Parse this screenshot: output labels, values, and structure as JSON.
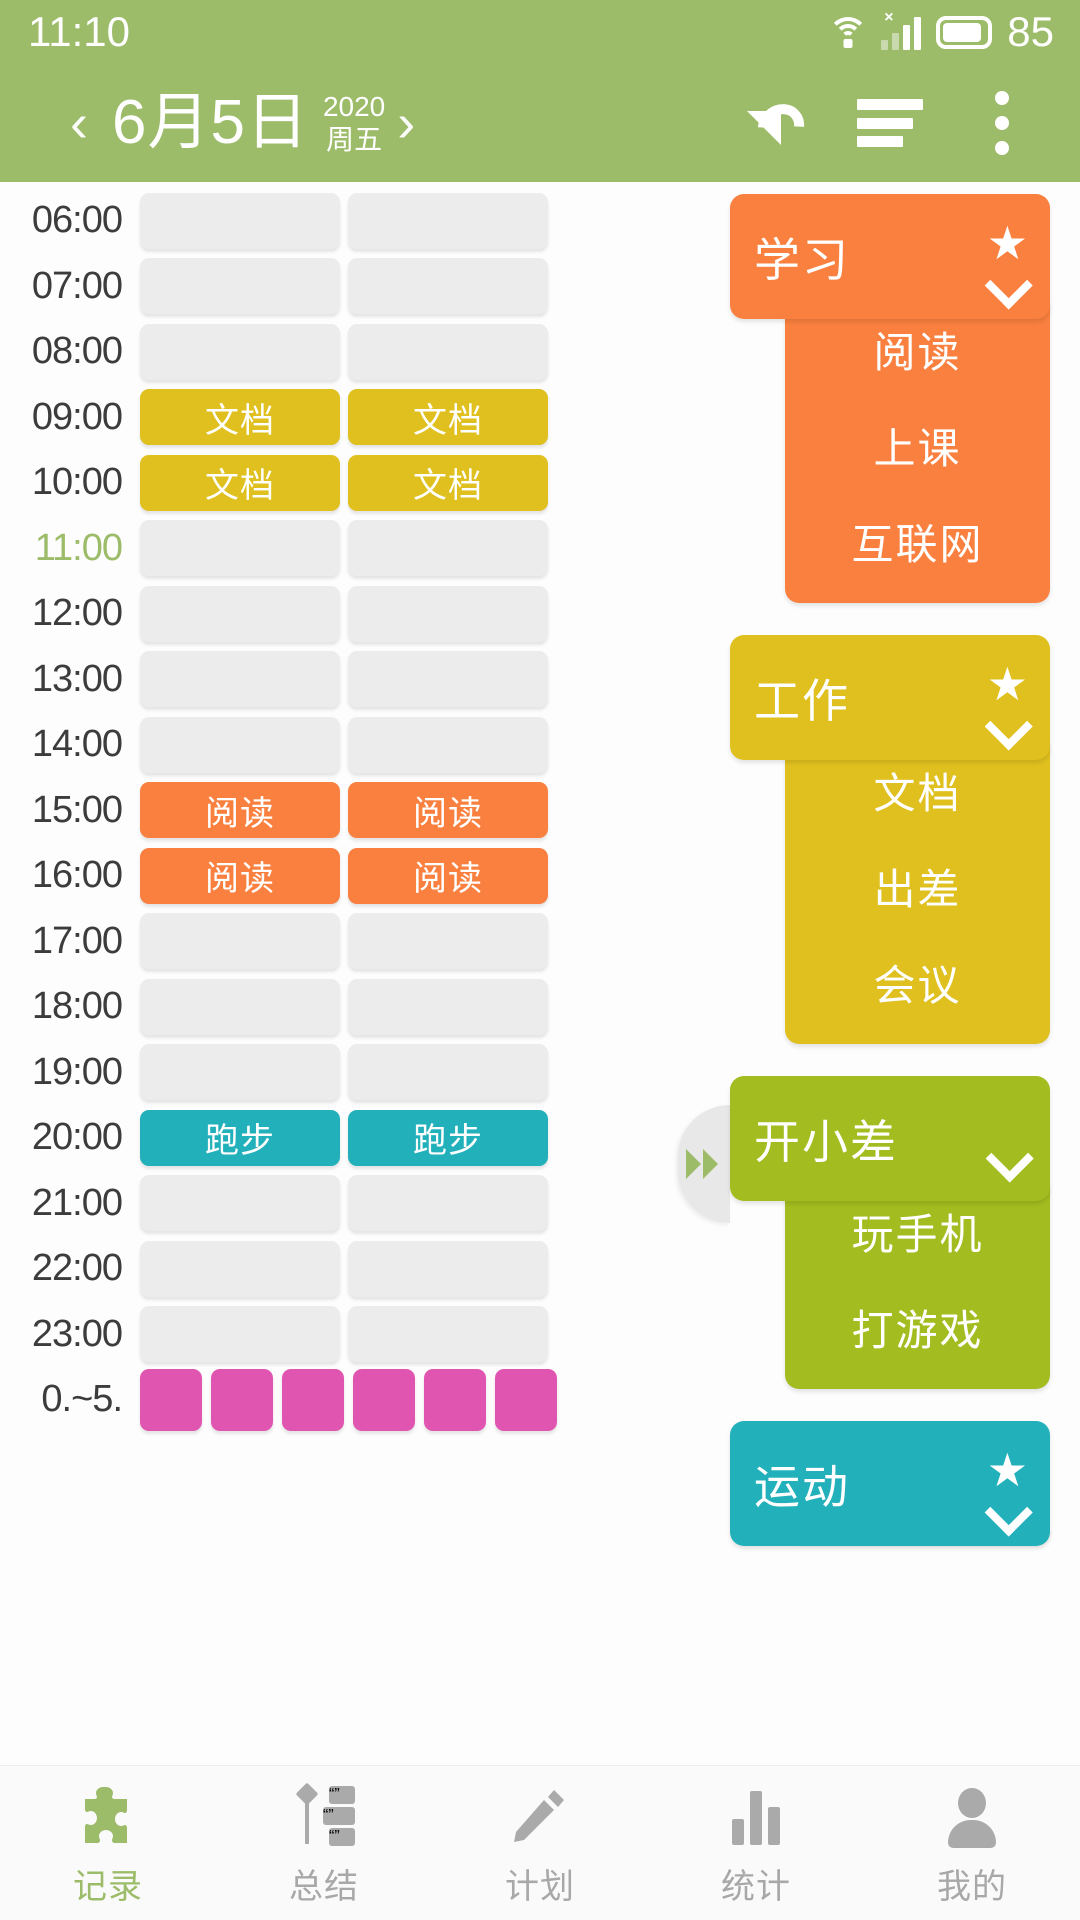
{
  "status_bar": {
    "time": "11:10",
    "battery_percent": "85",
    "wifi_icon": "wifi-icon",
    "signal_icon": "signal-bars-icon",
    "battery_icon": "battery-icon",
    "no_sim_mark": "×"
  },
  "app_bar": {
    "prev_label": "‹",
    "next_label": "›",
    "date": "6月5日",
    "year": "2020",
    "weekday": "周五",
    "undo_icon": "undo-icon",
    "lines_icon": "align-lines-icon",
    "overflow_icon": "more-vertical-icon"
  },
  "timeline": {
    "rows": [
      {
        "time": "06:00",
        "now": false,
        "cells": [
          {
            "label": "",
            "color": "#ececec"
          },
          {
            "label": "",
            "color": "#ececec"
          }
        ]
      },
      {
        "time": "07:00",
        "now": false,
        "cells": [
          {
            "label": "",
            "color": "#ececec"
          },
          {
            "label": "",
            "color": "#ececec"
          }
        ]
      },
      {
        "time": "08:00",
        "now": false,
        "cells": [
          {
            "label": "",
            "color": "#ececec"
          },
          {
            "label": "",
            "color": "#ececec"
          }
        ]
      },
      {
        "time": "09:00",
        "now": false,
        "cells": [
          {
            "label": "文档",
            "color": "#dfc01f"
          },
          {
            "label": "文档",
            "color": "#dfc01f"
          }
        ]
      },
      {
        "time": "10:00",
        "now": false,
        "cells": [
          {
            "label": "文档",
            "color": "#dfc01f"
          },
          {
            "label": "文档",
            "color": "#dfc01f"
          }
        ]
      },
      {
        "time": "11:00",
        "now": true,
        "cells": [
          {
            "label": "",
            "color": "#ececec"
          },
          {
            "label": "",
            "color": "#ececec"
          }
        ]
      },
      {
        "time": "12:00",
        "now": false,
        "cells": [
          {
            "label": "",
            "color": "#ececec"
          },
          {
            "label": "",
            "color": "#ececec"
          }
        ]
      },
      {
        "time": "13:00",
        "now": false,
        "cells": [
          {
            "label": "",
            "color": "#ececec"
          },
          {
            "label": "",
            "color": "#ececec"
          }
        ]
      },
      {
        "time": "14:00",
        "now": false,
        "cells": [
          {
            "label": "",
            "color": "#ececec"
          },
          {
            "label": "",
            "color": "#ececec"
          }
        ]
      },
      {
        "time": "15:00",
        "now": false,
        "cells": [
          {
            "label": "阅读",
            "color": "#f9803f"
          },
          {
            "label": "阅读",
            "color": "#f9803f"
          }
        ]
      },
      {
        "time": "16:00",
        "now": false,
        "cells": [
          {
            "label": "阅读",
            "color": "#f9803f"
          },
          {
            "label": "阅读",
            "color": "#f9803f"
          }
        ]
      },
      {
        "time": "17:00",
        "now": false,
        "cells": [
          {
            "label": "",
            "color": "#ececec"
          },
          {
            "label": "",
            "color": "#ececec"
          }
        ]
      },
      {
        "time": "18:00",
        "now": false,
        "cells": [
          {
            "label": "",
            "color": "#ececec"
          },
          {
            "label": "",
            "color": "#ececec"
          }
        ]
      },
      {
        "time": "19:00",
        "now": false,
        "cells": [
          {
            "label": "",
            "color": "#ececec"
          },
          {
            "label": "",
            "color": "#ececec"
          }
        ]
      },
      {
        "time": "20:00",
        "now": false,
        "cells": [
          {
            "label": "跑步",
            "color": "#22b0bb"
          },
          {
            "label": "跑步",
            "color": "#22b0bb"
          }
        ]
      },
      {
        "time": "21:00",
        "now": false,
        "cells": [
          {
            "label": "",
            "color": "#ececec"
          },
          {
            "label": "",
            "color": "#ececec"
          }
        ]
      },
      {
        "time": "22:00",
        "now": false,
        "cells": [
          {
            "label": "",
            "color": "#ececec"
          },
          {
            "label": "",
            "color": "#ececec"
          }
        ]
      },
      {
        "time": "23:00",
        "now": false,
        "cells": [
          {
            "label": "",
            "color": "#ececec"
          },
          {
            "label": "",
            "color": "#ececec"
          }
        ]
      }
    ],
    "summary_row": {
      "time": "0.~5.",
      "cells": [
        {
          "label": "",
          "color": "#e055b0"
        },
        {
          "label": "",
          "color": "#e055b0"
        },
        {
          "label": "",
          "color": "#e055b0"
        },
        {
          "label": "",
          "color": "#e055b0"
        },
        {
          "label": "",
          "color": "#e055b0"
        },
        {
          "label": "",
          "color": "#e055b0"
        }
      ]
    },
    "drag_handle_icon": "fast-forward-icon"
  },
  "categories": [
    {
      "title": "学习",
      "color": "#f9803f",
      "starred": true,
      "star_glyph": "★",
      "expanded": true,
      "items": [
        "阅读",
        "上课",
        "互联网"
      ]
    },
    {
      "title": "工作",
      "color": "#dfc01f",
      "starred": true,
      "star_glyph": "★",
      "expanded": true,
      "items": [
        "文档",
        "出差",
        "会议"
      ]
    },
    {
      "title": "开小差",
      "color": "#a3bc1f",
      "starred": false,
      "star_glyph": "",
      "expanded": true,
      "items": [
        "玩手机",
        "打游戏"
      ]
    },
    {
      "title": "运动",
      "color": "#22b0bb",
      "starred": true,
      "star_glyph": "★",
      "expanded": true,
      "items": []
    }
  ],
  "bottom_nav": {
    "active_index": 0,
    "items": [
      {
        "label": "记录",
        "icon": "puzzle-icon"
      },
      {
        "label": "总结",
        "icon": "summary-list-icon"
      },
      {
        "label": "计划",
        "icon": "pencil-icon"
      },
      {
        "label": "统计",
        "icon": "bar-chart-icon"
      },
      {
        "label": "我的",
        "icon": "person-icon"
      }
    ]
  },
  "colors": {
    "brand_green": "#9cbc6a",
    "study_orange": "#f9803f",
    "work_yellow": "#dfc01f",
    "distract_olive": "#a3bc1f",
    "sport_teal": "#22b0bb",
    "summary_pink": "#e055b0",
    "empty_cell": "#ececec"
  }
}
